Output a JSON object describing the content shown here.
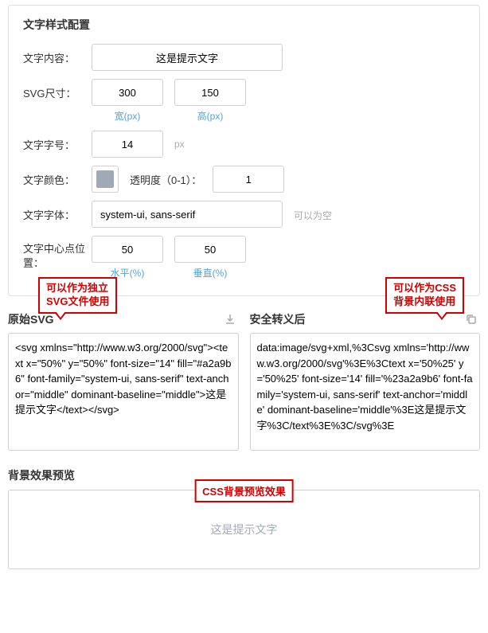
{
  "panel": {
    "title": "文字样式配置",
    "rows": {
      "content": {
        "label": "文字内容：",
        "value": "这是提示文字"
      },
      "size": {
        "label": "SVG尺寸：",
        "w": "300",
        "h": "150",
        "wHint": "宽(px)",
        "hHint": "高(px)"
      },
      "fontSize": {
        "label": "文字字号：",
        "value": "14",
        "unit": "px"
      },
      "color": {
        "label": "文字颜色：",
        "opacityLabel": "透明度（0-1）：",
        "opacity": "1"
      },
      "font": {
        "label": "文字字体：",
        "value": "system-ui, sans-serif",
        "hint": "可以为空"
      },
      "center": {
        "label": "文字中心点位置：",
        "x": "50",
        "y": "50",
        "xHint": "水平(%)",
        "yHint": "垂直(%)"
      }
    }
  },
  "output": {
    "raw": {
      "title": "原始SVG",
      "callout": "可以作为独立\nSVG文件使用",
      "text": "<svg xmlns=\"http://www.w3.org/2000/svg\"><text x=\"50%\" y=\"50%\" font-size=\"14\" fill=\"#a2a9b6\" font-family=\"system-ui, sans-serif\" text-anchor=\"middle\" dominant-baseline=\"middle\">这是提示文字</text></svg>"
    },
    "escaped": {
      "title": "安全转义后",
      "callout": "可以作为CSS\n背景内联使用",
      "text": "data:image/svg+xml,%3Csvg xmlns='http://www.w3.org/2000/svg'%3E%3Ctext x='50%25' y='50%25' font-size='14' fill='%23a2a9b6' font-family='system-ui, sans-serif' text-anchor='middle' dominant-baseline='middle'%3E这是提示文字%3C/text%3E%3C/svg%3E"
    }
  },
  "preview": {
    "title": "背景效果预览",
    "callout": "CSS背景预览效果",
    "text": "这是提示文字"
  }
}
